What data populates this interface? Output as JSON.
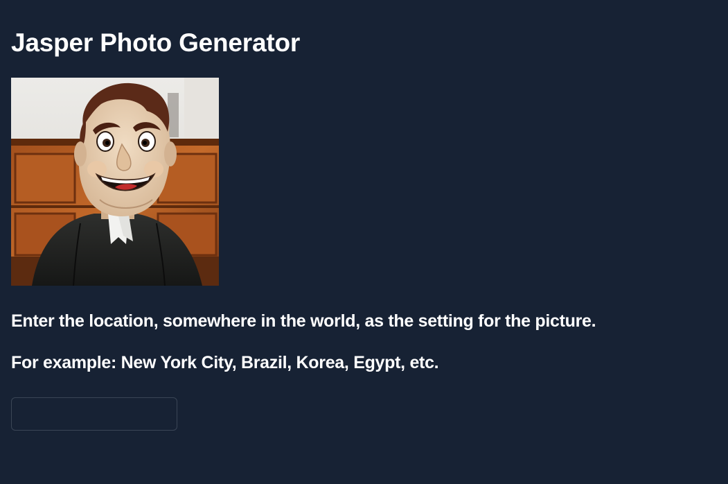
{
  "page": {
    "title": "Jasper Photo Generator"
  },
  "photo": {
    "subject": "mascot-photo"
  },
  "instructions": {
    "line1": "Enter the location, somewhere in the world, as the setting for the picture.",
    "line2": "For example: New York City, Brazil, Korea, Egypt, etc."
  },
  "location_input": {
    "value": "",
    "placeholder": ""
  },
  "colors": {
    "background": "#172234",
    "text": "#ffffff",
    "input_border": "#3b4656"
  }
}
